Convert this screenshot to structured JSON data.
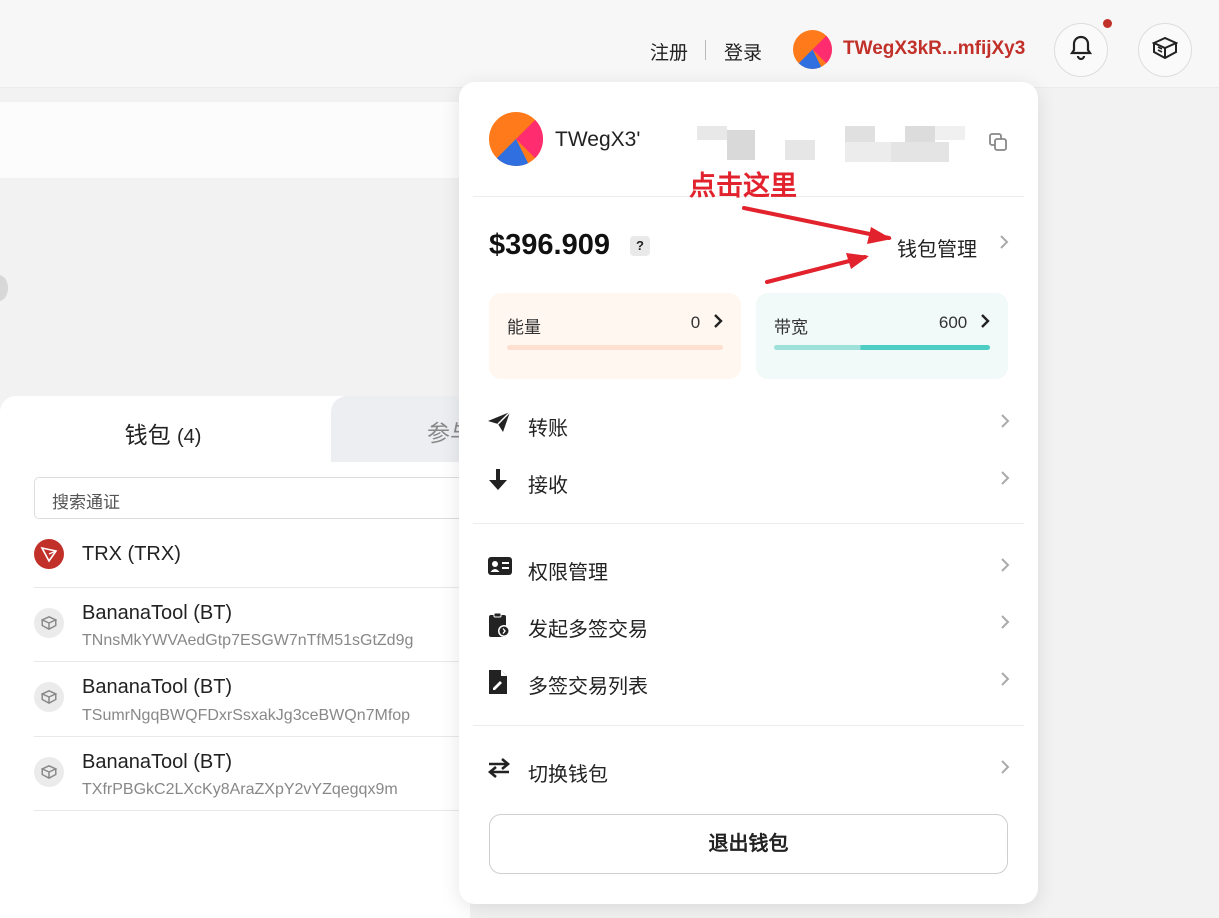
{
  "header": {
    "register": "注册",
    "login": "登录",
    "address_short": "TWegX3kR...mfijXy3"
  },
  "tabs": {
    "wallet_label": "钱包",
    "wallet_count": "(4)",
    "other_label": "参与"
  },
  "search": {
    "placeholder": "搜索通证"
  },
  "tokens": [
    {
      "name": "TRX (TRX)",
      "address": ""
    },
    {
      "name": "BananaTool (BT)",
      "address": "TNnsMkYWVAedGtp7ESGW7nTfM51sGtZd9g"
    },
    {
      "name": "BananaTool (BT)",
      "address": "TSumrNgqBWQFDxrSsxakJg3ceBWQn7Mfop"
    },
    {
      "name": "BananaTool (BT)",
      "address": "TXfrPBGkC2LXcKy8AraZXpY2vYZqegqx9m"
    }
  ],
  "dropdown": {
    "account_name": "TWegX3'",
    "annotation": "点击这里",
    "balance": "$396.909",
    "help_badge": "?",
    "wallet_management": "钱包管理",
    "energy": {
      "label": "能量",
      "value": "0",
      "fill": 0
    },
    "bandwidth": {
      "label": "带宽",
      "value": "600",
      "fill": 1.0
    },
    "menu": {
      "transfer": "转账",
      "receive": "接收",
      "permissions": "权限管理",
      "multisig_start": "发起多签交易",
      "multisig_list": "多签交易列表",
      "switch_wallet": "切换钱包"
    },
    "logout": "退出钱包"
  },
  "colors": {
    "accent_red": "#c2302a",
    "annotation_red": "#e2232d",
    "energy_bg": "#fff7f0",
    "energy_track": "#fde0cf",
    "bandwidth_bg": "#f2f9f9",
    "bandwidth_track": "#4ecdc4"
  }
}
